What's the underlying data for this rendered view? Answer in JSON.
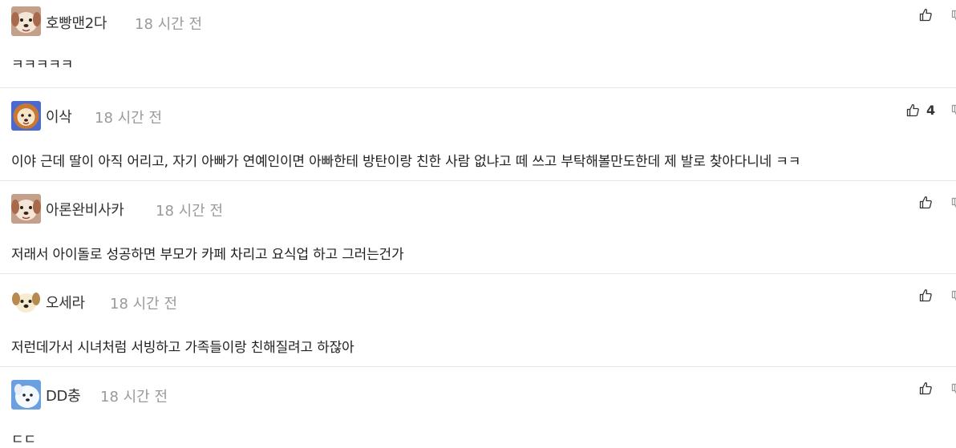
{
  "comments": [
    {
      "username": "호빵맨2다",
      "time": "18 시간 전",
      "text": "ㅋㅋㅋㅋㅋ",
      "likes": "",
      "avatar_icon": "dog-face-icon"
    },
    {
      "username": "이삭",
      "time": "18 시간 전",
      "text": "이야 근데 딸이 아직 어리고, 자기 아빠가 연예인이면 아빠한테 방탄이랑 친한 사람 없냐고 떼 쓰고 부탁해볼만도한데 제 발로 찾아다니네 ㅋㅋ",
      "likes": "4",
      "avatar_icon": "lion-face-icon"
    },
    {
      "username": "아론완비사카",
      "time": "18 시간 전",
      "text": "저래서 아이돌로 성공하면 부모가 카페 차리고 요식업 하고 그러는건가",
      "likes": "",
      "avatar_icon": "dog-face-icon"
    },
    {
      "username": "오세라",
      "time": "18 시간 전",
      "text": "저런데가서 시녀처럼 서빙하고 가족들이랑 친해질려고 하잖아",
      "likes": "",
      "avatar_icon": "puppy-face-icon"
    },
    {
      "username": "DD충",
      "time": "18 시간 전",
      "text": "ㄷㄷ",
      "likes": "",
      "avatar_icon": "white-dog-icon"
    }
  ],
  "icons": {
    "like": "thumbs-up-icon",
    "dislike": "thumbs-down-icon"
  },
  "colors": {
    "text": "#222222",
    "time": "#9a9a9a",
    "divider": "#e6e6e6"
  }
}
